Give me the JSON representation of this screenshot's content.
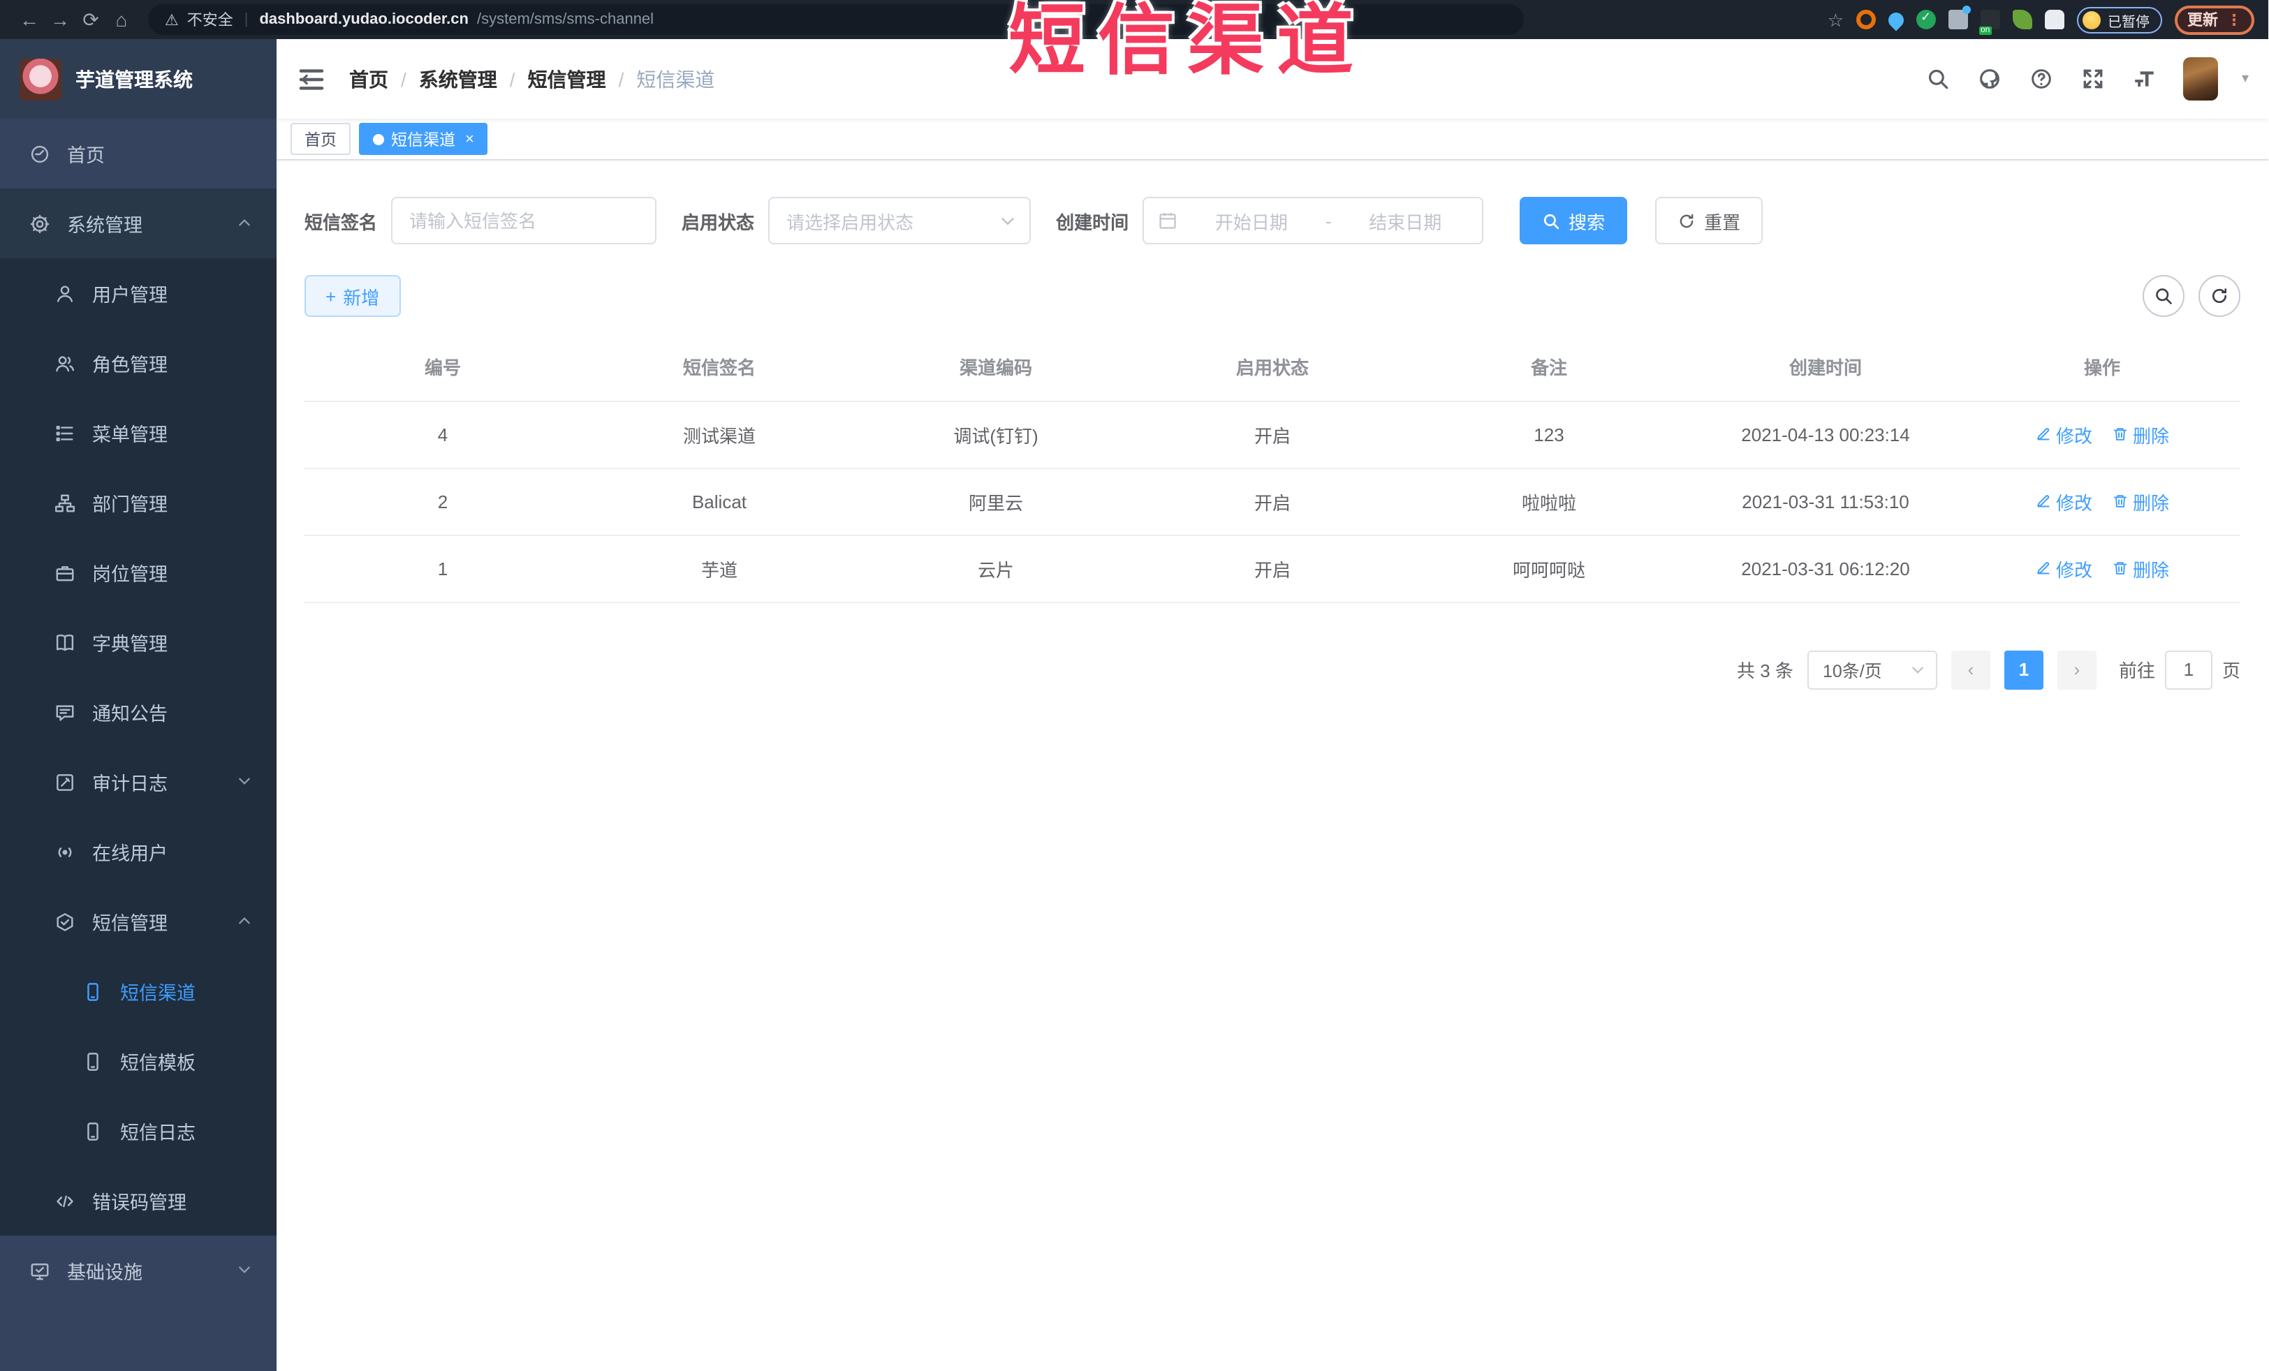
{
  "colors": {
    "accent": "#409eff",
    "overlay_red": "#f43b5e",
    "sidebar_bg": "#36435e",
    "submenu_bg": "#1f2d3d"
  },
  "overlay": {
    "title": "短信渠道"
  },
  "browser": {
    "security_label": "不安全",
    "url_host": "dashboard.yudao.iocoder.cn",
    "url_path": "/system/sms/sms-channel",
    "paused_badge": "已暂停",
    "update_button": "更新"
  },
  "sidebar": {
    "app_title": "芋道管理系统",
    "items": [
      {
        "label": "首页",
        "icon": "dashboard",
        "level": 1
      },
      {
        "label": "系统管理",
        "icon": "gear",
        "level": 1,
        "chevron": "up",
        "open": true
      },
      {
        "label": "用户管理",
        "icon": "user",
        "level": 2
      },
      {
        "label": "角色管理",
        "icon": "role",
        "level": 2
      },
      {
        "label": "菜单管理",
        "icon": "menu",
        "level": 2
      },
      {
        "label": "部门管理",
        "icon": "tree",
        "level": 2
      },
      {
        "label": "岗位管理",
        "icon": "post",
        "level": 2
      },
      {
        "label": "字典管理",
        "icon": "dict",
        "level": 2
      },
      {
        "label": "通知公告",
        "icon": "notice",
        "level": 2
      },
      {
        "label": "审计日志",
        "icon": "log",
        "level": 2,
        "chevron": "down"
      },
      {
        "label": "在线用户",
        "icon": "online",
        "level": 2
      },
      {
        "label": "短信管理",
        "icon": "sms",
        "level": 2,
        "chevron": "up"
      },
      {
        "label": "短信渠道",
        "icon": "phone",
        "level": 3,
        "active": true
      },
      {
        "label": "短信模板",
        "icon": "phone",
        "level": 3
      },
      {
        "label": "短信日志",
        "icon": "phone",
        "level": 3
      },
      {
        "label": "错误码管理",
        "icon": "code",
        "level": 2
      },
      {
        "label": "基础设施",
        "icon": "monitor",
        "level": 1,
        "chevron": "down"
      }
    ]
  },
  "header": {
    "breadcrumb": [
      "首页",
      "系统管理",
      "短信管理",
      "短信渠道"
    ]
  },
  "tabs": [
    {
      "label": "首页",
      "active": false,
      "closable": false
    },
    {
      "label": "短信渠道",
      "active": true,
      "closable": true
    }
  ],
  "filters": {
    "sign_label": "短信签名",
    "sign_placeholder": "请输入短信签名",
    "status_label": "启用状态",
    "status_placeholder": "请选择启用状态",
    "time_label": "创建时间",
    "start_placeholder": "开始日期",
    "range_separator": "-",
    "end_placeholder": "结束日期",
    "search_label": "搜索",
    "reset_label": "重置"
  },
  "toolbar": {
    "add_label": "新增"
  },
  "table": {
    "columns": [
      "编号",
      "短信签名",
      "渠道编码",
      "启用状态",
      "备注",
      "创建时间",
      "操作"
    ],
    "rows": [
      {
        "id": "4",
        "sign": "测试渠道",
        "code": "调试(钉钉)",
        "status": "开启",
        "remark": "123",
        "created": "2021-04-13 00:23:14"
      },
      {
        "id": "2",
        "sign": "Balicat",
        "code": "阿里云",
        "status": "开启",
        "remark": "啦啦啦",
        "created": "2021-03-31 11:53:10"
      },
      {
        "id": "1",
        "sign": "芋道",
        "code": "云片",
        "status": "开启",
        "remark": "呵呵呵哒",
        "created": "2021-03-31 06:12:20"
      }
    ],
    "edit_label": "修改",
    "delete_label": "删除"
  },
  "pagination": {
    "total_label": "共 3 条",
    "page_size_label": "10条/页",
    "current_page": "1",
    "goto_label": "前往",
    "goto_value": "1",
    "page_unit": "页"
  }
}
